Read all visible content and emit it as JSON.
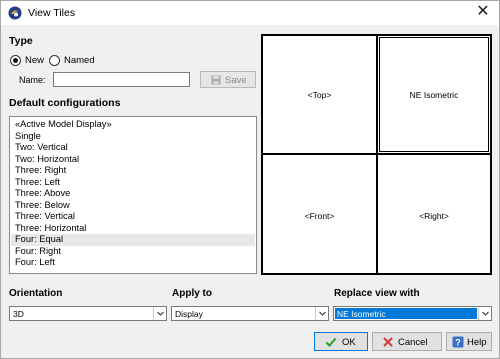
{
  "window": {
    "title": "View Tiles",
    "close_symbol": "✕"
  },
  "type_section": {
    "title": "Type",
    "radio_new": {
      "label": "New",
      "checked": true
    },
    "radio_named": {
      "label": "Named",
      "checked": false
    },
    "name_label": "Name:",
    "name_value": "",
    "save_label": "Save"
  },
  "configs": {
    "title": "Default configurations",
    "items": [
      "«Active Model Display»",
      "Single",
      "Two: Vertical",
      "Two: Horizontal",
      "Three: Right",
      "Three: Left",
      "Three: Above",
      "Three: Below",
      "Three: Vertical",
      "Three: Horizontal",
      "Four: Equal",
      "Four: Right",
      "Four: Left"
    ],
    "selected_index": 10
  },
  "preview": {
    "tiles": [
      "<Top>",
      "NE Isometric",
      "<Front>",
      "<Right>"
    ],
    "active_tile": "NE Isometric"
  },
  "orientation": {
    "label": "Orientation",
    "value": "3D"
  },
  "apply_to": {
    "label": "Apply to",
    "value": "Display"
  },
  "replace_view": {
    "label": "Replace view with",
    "value": "NE Isometric"
  },
  "buttons": {
    "ok": "OK",
    "cancel": "Cancel",
    "help": "Help"
  },
  "colors": {
    "accent": "#0078d7",
    "ok_check": "#2e9b2e",
    "cancel_x": "#d23b3b",
    "help_blue": "#3b6fc9"
  }
}
